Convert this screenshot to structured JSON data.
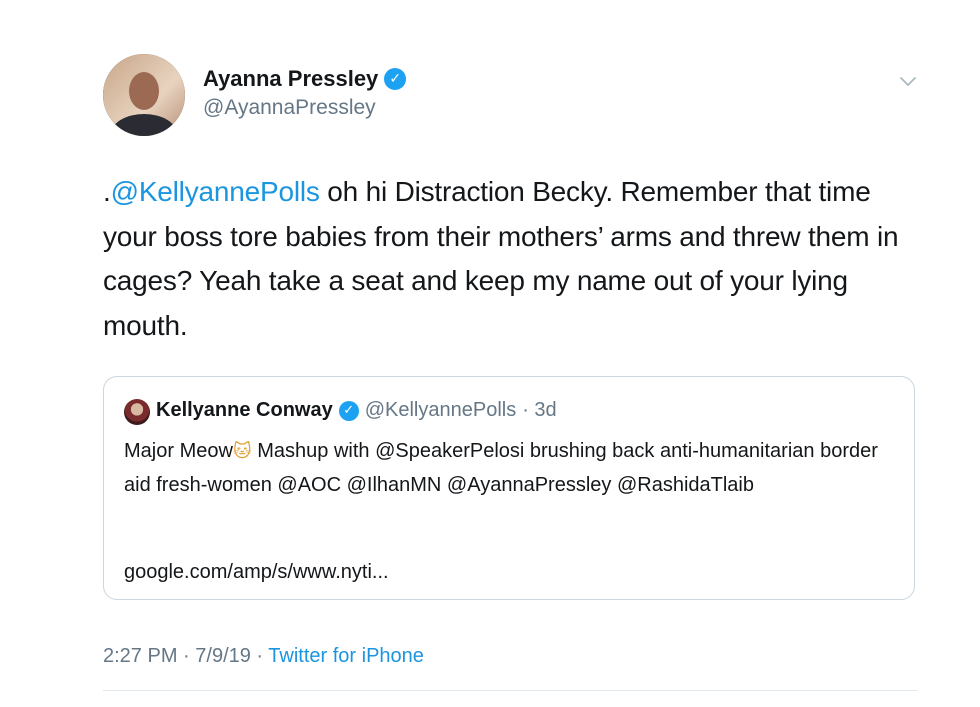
{
  "tweet": {
    "author_name": "Ayanna Pressley",
    "author_handle": "@AyannaPressley",
    "verified_icon": "verified-badge-icon",
    "text_prefix": ".",
    "text_mention": "@KellyannePolls",
    "text_body": " oh hi Distraction Becky. Remember that time your boss tore babies from their mothers’ arms and threw them in cages? Yeah take a seat and keep my name out of your lying mouth.",
    "time": "2:27 PM",
    "separator": " · ",
    "date": "7/9/19",
    "client": "Twitter for iPhone"
  },
  "quoted": {
    "author_name": "Kellyanne Conway",
    "author_handle": "@KellyannePolls",
    "age": "· 3d",
    "text_before_emoji": "Major Meow",
    "emoji": "🐱",
    "text_after_emoji": " Mashup with @SpeakerPelosi brushing back anti-humanitarian border aid fresh-women @AOC @IlhanMN @AyannaPressley @RashidaTlaib",
    "link": "google.com/amp/s/www.nyti..."
  },
  "colors": {
    "accent": "#1b95e0",
    "verified": "#1da1f2",
    "muted": "#657786",
    "text": "#14171a"
  }
}
